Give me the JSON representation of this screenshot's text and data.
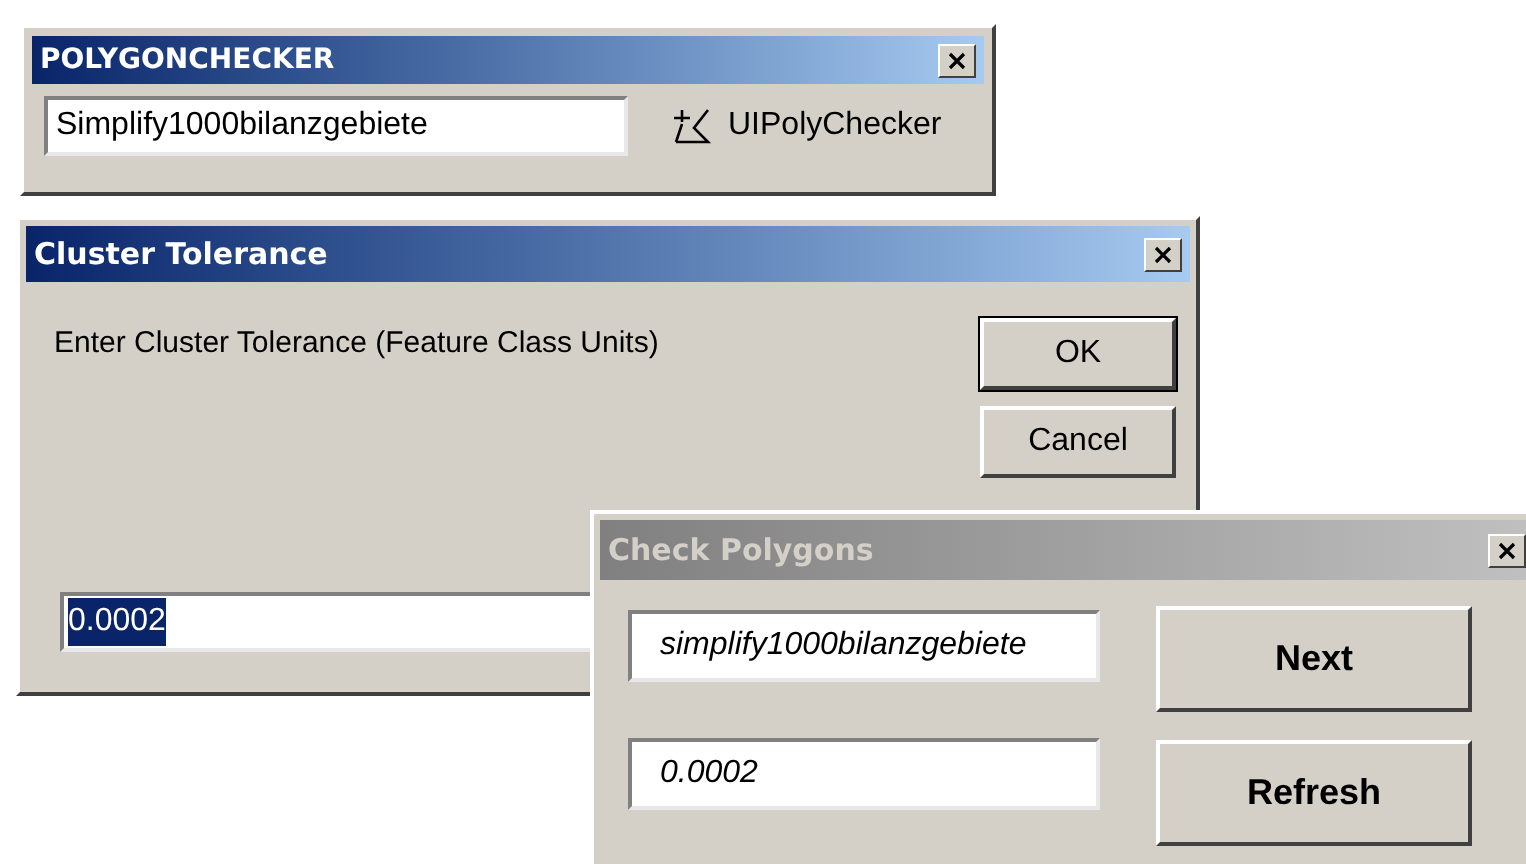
{
  "windows": [
    {
      "title": "POLYGONCHECKER",
      "active": true,
      "field": {
        "value": "Simplify1000bilanzgebiete"
      },
      "tool_label": "UIPolyChecker"
    },
    {
      "title": "Cluster Tolerance",
      "active": true,
      "prompt": "Enter Cluster Tolerance (Feature Class Units)",
      "buttons": [
        "OK",
        "Cancel"
      ],
      "field": {
        "value": "0.0002",
        "text_selected": true
      }
    },
    {
      "title": "Check Polygons",
      "active": false,
      "fields": [
        {
          "value": "simplify1000bilanzgebiete"
        },
        {
          "value": "0.0002"
        }
      ],
      "buttons": [
        "Next",
        "Refresh"
      ]
    }
  ]
}
